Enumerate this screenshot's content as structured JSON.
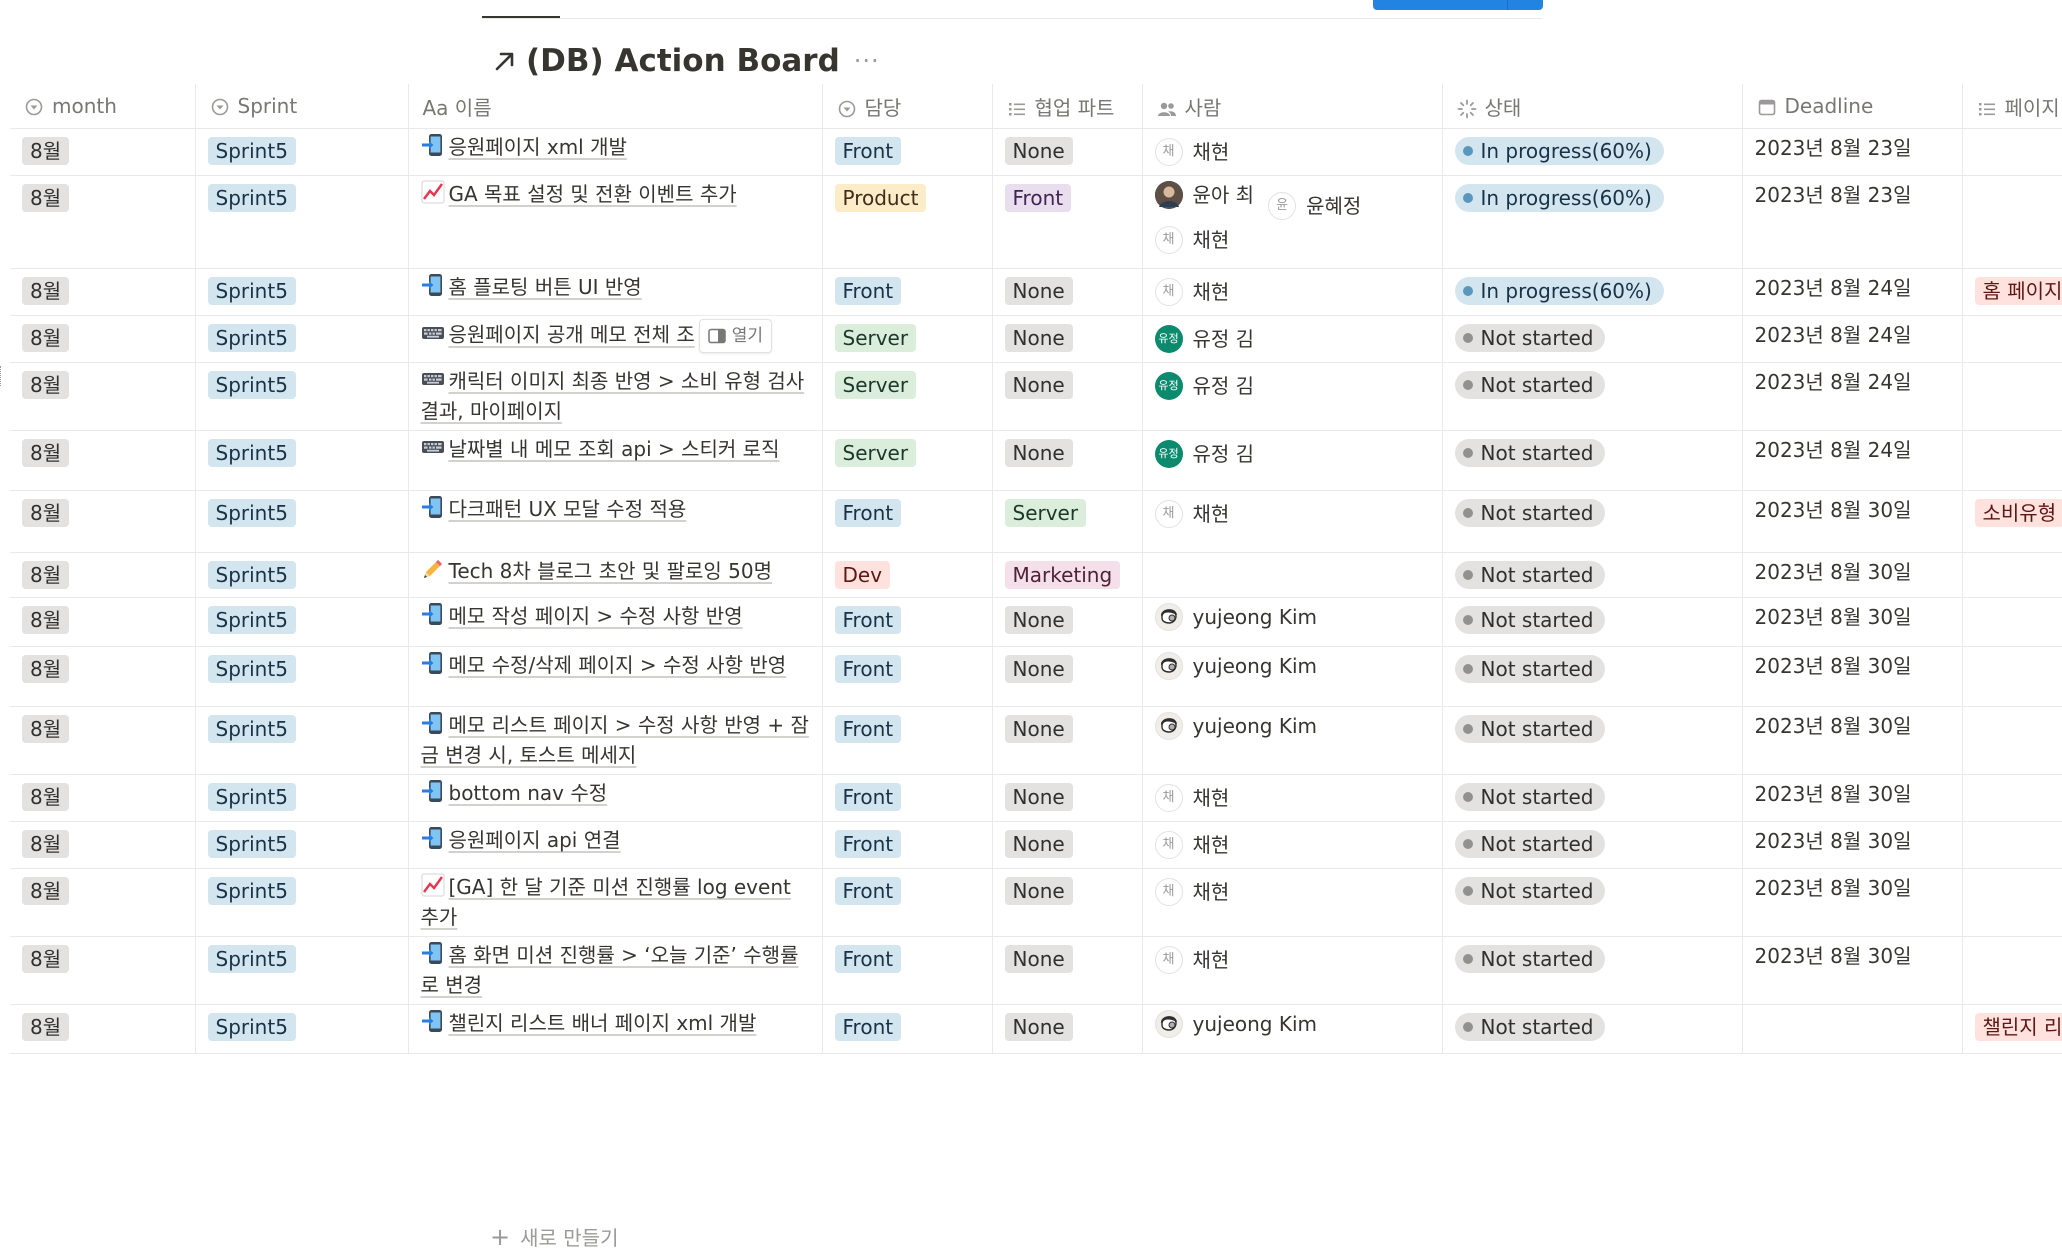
{
  "board": {
    "title": "(DB) Action Board",
    "more": "···",
    "open_label": "열기",
    "new_label": "새로 만들기"
  },
  "columns": [
    {
      "label": "month",
      "icon": "select-icon"
    },
    {
      "label": "Sprint",
      "icon": "select-icon"
    },
    {
      "label": "Aa 이름",
      "icon": "none"
    },
    {
      "label": "담당",
      "icon": "select-icon"
    },
    {
      "label": "협업 파트",
      "icon": "list-icon"
    },
    {
      "label": "사람",
      "icon": "people-icon"
    },
    {
      "label": "상태",
      "icon": "status-icon"
    },
    {
      "label": "Deadline",
      "icon": "calendar-icon"
    },
    {
      "label": "페이지",
      "icon": "list-icon"
    }
  ],
  "rows": [
    {
      "month": "8월",
      "sprint": "Sprint5",
      "emoji": "phone",
      "name": "응원페이지 xml 개발",
      "owner": "Front",
      "owner_color": "blue",
      "collab": "None",
      "collab_color": "gray",
      "people": [
        {
          "name": "채현",
          "avatar": "letter",
          "initial": "채"
        }
      ],
      "status": "In progress(60%)",
      "status_kind": "progress",
      "deadline": "2023년 8월 23일",
      "page": ""
    },
    {
      "month": "8월",
      "sprint": "Sprint5",
      "emoji": "chart",
      "name": "GA 목표 설정 및 전환 이벤트 추가",
      "owner": "Product",
      "owner_color": "yellow",
      "collab": "Front",
      "collab_color": "purple",
      "people": [
        {
          "name": "윤아 최",
          "avatar": "photo",
          "initial": ""
        },
        {
          "name": "윤혜정",
          "avatar": "letter",
          "initial": "윤"
        },
        {
          "name": "채현",
          "avatar": "letter",
          "initial": "채"
        }
      ],
      "status": "In progress(60%)",
      "status_kind": "progress",
      "deadline": "2023년 8월 23일",
      "page": ""
    },
    {
      "month": "8월",
      "sprint": "Sprint5",
      "emoji": "phone",
      "name": "홈 플로팅 버튼 UI 반영",
      "owner": "Front",
      "owner_color": "blue",
      "collab": "None",
      "collab_color": "gray",
      "people": [
        {
          "name": "채현",
          "avatar": "letter",
          "initial": "채"
        }
      ],
      "status": "In progress(60%)",
      "status_kind": "progress",
      "deadline": "2023년 8월 24일",
      "page": "홈 페이지"
    },
    {
      "month": "8월",
      "sprint": "Sprint5",
      "emoji": "keyboard",
      "name": "응원페이지 공개 메모 전체 조",
      "owner": "Server",
      "owner_color": "green",
      "collab": "None",
      "collab_color": "gray",
      "people": [
        {
          "name": "유정 김",
          "avatar": "green",
          "initial": "유정"
        }
      ],
      "status": "Not started",
      "status_kind": "not",
      "deadline": "2023년 8월 24일",
      "page": "",
      "hover": true
    },
    {
      "month": "8월",
      "sprint": "Sprint5",
      "emoji": "keyboard",
      "name": "캐릭터 이미지 최종 반영 > 소비 유형 검사 결과, 마이페이지",
      "owner": "Server",
      "owner_color": "green",
      "collab": "None",
      "collab_color": "gray",
      "people": [
        {
          "name": "유정 김",
          "avatar": "green",
          "initial": "유정"
        }
      ],
      "status": "Not started",
      "status_kind": "not",
      "deadline": "2023년 8월 24일",
      "page": ""
    },
    {
      "month": "8월",
      "sprint": "Sprint5",
      "emoji": "keyboard",
      "name": "날짜별 내 메모 조회 api > 스티커 로직",
      "owner": "Server",
      "owner_color": "green",
      "collab": "None",
      "collab_color": "gray",
      "people": [
        {
          "name": "유정 김",
          "avatar": "green",
          "initial": "유정"
        }
      ],
      "status": "Not started",
      "status_kind": "not",
      "deadline": "2023년 8월 24일",
      "page": ""
    },
    {
      "month": "8월",
      "sprint": "Sprint5",
      "emoji": "phone",
      "name": "다크패턴 UX 모달 수정 적용",
      "owner": "Front",
      "owner_color": "blue",
      "collab": "Server",
      "collab_color": "green",
      "people": [
        {
          "name": "채현",
          "avatar": "letter",
          "initial": "채"
        }
      ],
      "status": "Not started",
      "status_kind": "not",
      "deadline": "2023년 8월 30일",
      "page": "소비유형",
      "tall": true
    },
    {
      "month": "8월",
      "sprint": "Sprint5",
      "emoji": "pencil",
      "name": "Tech 8차 블로그 초안 및 팔로잉 50명",
      "owner": "Dev",
      "owner_color": "red",
      "collab": "Marketing",
      "collab_color": "pink",
      "people": [],
      "status": "Not started",
      "status_kind": "not",
      "deadline": "2023년 8월 30일",
      "page": ""
    },
    {
      "month": "8월",
      "sprint": "Sprint5",
      "emoji": "phone",
      "name": "메모 작성 페이지 > 수정 사항 반영",
      "owner": "Front",
      "owner_color": "blue",
      "collab": "None",
      "collab_color": "gray",
      "people": [
        {
          "name": "yujeong Kim",
          "avatar": "cartoon",
          "initial": ""
        }
      ],
      "status": "Not started",
      "status_kind": "not",
      "deadline": "2023년 8월 30일",
      "page": ""
    },
    {
      "month": "8월",
      "sprint": "Sprint5",
      "emoji": "phone",
      "name": "메모 수정/삭제 페이지 > 수정 사항 반영",
      "owner": "Front",
      "owner_color": "blue",
      "collab": "None",
      "collab_color": "gray",
      "people": [
        {
          "name": "yujeong Kim",
          "avatar": "cartoon",
          "initial": ""
        }
      ],
      "status": "Not started",
      "status_kind": "not",
      "deadline": "2023년 8월 30일",
      "page": ""
    },
    {
      "month": "8월",
      "sprint": "Sprint5",
      "emoji": "phone",
      "name": "메모 리스트 페이지 > 수정 사항 반영 + 잠금 변경 시, 토스트 메세지",
      "owner": "Front",
      "owner_color": "blue",
      "collab": "None",
      "collab_color": "gray",
      "people": [
        {
          "name": "yujeong Kim",
          "avatar": "cartoon",
          "initial": ""
        }
      ],
      "status": "Not started",
      "status_kind": "not",
      "deadline": "2023년 8월 30일",
      "page": ""
    },
    {
      "month": "8월",
      "sprint": "Sprint5",
      "emoji": "phone",
      "name": "bottom nav 수정",
      "owner": "Front",
      "owner_color": "blue",
      "collab": "None",
      "collab_color": "gray",
      "people": [
        {
          "name": "채현",
          "avatar": "letter",
          "initial": "채"
        }
      ],
      "status": "Not started",
      "status_kind": "not",
      "deadline": "2023년 8월 30일",
      "page": ""
    },
    {
      "month": "8월",
      "sprint": "Sprint5",
      "emoji": "phone",
      "name": "응원페이지 api 연결",
      "owner": "Front",
      "owner_color": "blue",
      "collab": "None",
      "collab_color": "gray",
      "people": [
        {
          "name": "채현",
          "avatar": "letter",
          "initial": "채"
        }
      ],
      "status": "Not started",
      "status_kind": "not",
      "deadline": "2023년 8월 30일",
      "page": ""
    },
    {
      "month": "8월",
      "sprint": "Sprint5",
      "emoji": "chart",
      "name": "[GA] 한 달 기준 미션 진행률 log event 추가",
      "owner": "Front",
      "owner_color": "blue",
      "collab": "None",
      "collab_color": "gray",
      "people": [
        {
          "name": "채현",
          "avatar": "letter",
          "initial": "채"
        }
      ],
      "status": "Not started",
      "status_kind": "not",
      "deadline": "2023년 8월 30일",
      "page": ""
    },
    {
      "month": "8월",
      "sprint": "Sprint5",
      "emoji": "phone",
      "name": "홈 화면 미션 진행률 > ‘오늘 기준’ 수행률로 변경",
      "owner": "Front",
      "owner_color": "blue",
      "collab": "None",
      "collab_color": "gray",
      "people": [
        {
          "name": "채현",
          "avatar": "letter",
          "initial": "채"
        }
      ],
      "status": "Not started",
      "status_kind": "not",
      "deadline": "2023년 8월 30일",
      "page": ""
    },
    {
      "month": "8월",
      "sprint": "Sprint5",
      "emoji": "phone",
      "name": "챌린지 리스트 배너 페이지 xml 개발",
      "owner": "Front",
      "owner_color": "blue",
      "collab": "None",
      "collab_color": "gray",
      "people": [
        {
          "name": "yujeong Kim",
          "avatar": "cartoon",
          "initial": ""
        }
      ],
      "status": "Not started",
      "status_kind": "not",
      "deadline": "",
      "page": "챌린지 리"
    }
  ]
}
